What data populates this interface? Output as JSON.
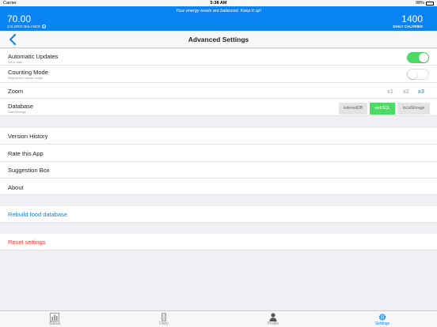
{
  "status_bar": {
    "carrier": "Carrier",
    "time": "5:38 AM",
    "battery": "98%"
  },
  "banner": {
    "message": "Your energy levels are balanced. Keep it up!",
    "caloric_balance_value": "70.00",
    "caloric_balance_label": "CALORIC BALANCE",
    "daily_calories_value": "1400",
    "daily_calories_label": "DAILY CALORIES"
  },
  "nav": {
    "title": "Advanced Settings"
  },
  "settings": {
    "auto_updates": {
      "label": "Automatic Updates",
      "sub": "Up to date",
      "enabled": true
    },
    "counting_mode": {
      "label": "Counting Mode",
      "sub": "Registered calorie usage",
      "enabled": false
    },
    "zoom": {
      "label": "Zoom",
      "options": [
        "x1",
        "x2",
        "x3"
      ],
      "selected": "x3"
    },
    "database": {
      "label": "Database",
      "sub": "Data storage",
      "options": [
        "indexedDB",
        "webSQL",
        "localStorage"
      ],
      "selected": "webSQL"
    }
  },
  "menu": [
    "Version History",
    "Rate this App",
    "Suggestion Box",
    "About"
  ],
  "actions": {
    "rebuild": "Rebuild food database",
    "reset": "Reset settings"
  },
  "tabs": [
    {
      "label": "Status",
      "icon": "bar-chart-icon"
    },
    {
      "label": "Diary",
      "icon": "utensils-icon"
    },
    {
      "label": "Profile",
      "icon": "person-icon"
    },
    {
      "label": "Settings",
      "icon": "gear-icon"
    }
  ],
  "active_tab": "Settings",
  "colors": {
    "accent": "#0a84f4",
    "toggle_on": "#4cd964",
    "danger": "#ff3b30"
  }
}
